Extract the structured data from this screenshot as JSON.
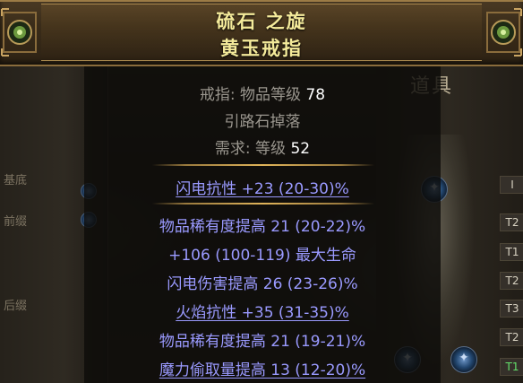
{
  "background": {
    "panel_title": "道具",
    "side_labels": [
      "基底",
      "前缀",
      "后缀"
    ],
    "tiers": [
      "I",
      "T2",
      "T1",
      "T2",
      "T3",
      "T2",
      "T1"
    ]
  },
  "item": {
    "name_line1": "硫石 之旋",
    "name_line2": "黄玉戒指",
    "item_class_label": "戒指:",
    "item_level_label": "物品等级",
    "item_level_value": "78",
    "source": "引路石掉落",
    "requirement_label": "需求:",
    "requirement_level_label": "等级",
    "requirement_level_value": "52",
    "implicit_mods": [
      "闪电抗性 +23 (20-30)%"
    ],
    "explicit_mods": [
      "物品稀有度提高 21 (20-22)%",
      "+106 (100-119) 最大生命",
      "闪电伤害提高 26 (23-26)%",
      "火焰抗性 +35 (31-35)%",
      "物品稀有度提高 21 (19-21)%",
      "魔力偷取量提高 13 (12-20)%"
    ]
  },
  "colors": {
    "name": "#f4ea9a",
    "mod": "#9a9aff",
    "header_border": "#8a6c3c",
    "tier_green": "#63e06b"
  },
  "icons": {
    "ornament": "gem-ornament-icon",
    "slot": "socket-orb-icon"
  }
}
